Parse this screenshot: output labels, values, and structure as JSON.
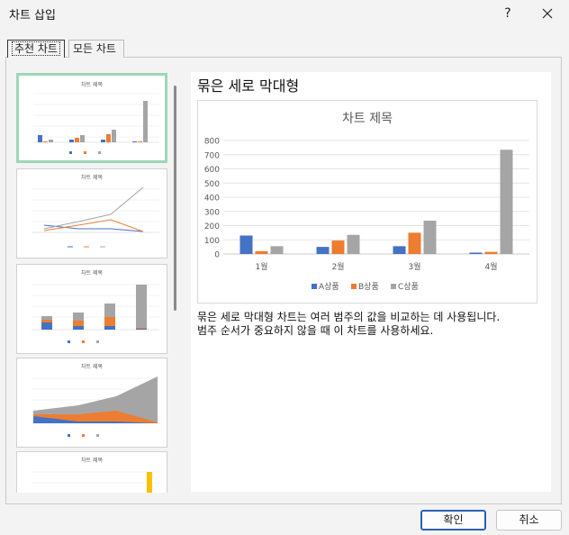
{
  "window": {
    "title": "차트 삽입",
    "help_label": "?"
  },
  "tabs": [
    {
      "label": "추천 차트",
      "selected": true
    },
    {
      "label": "모든 차트",
      "selected": false
    }
  ],
  "thumbnails": [
    {
      "title": "차트 제목",
      "kind": "clustered-column",
      "selected": true
    },
    {
      "title": "차트 제목",
      "kind": "line",
      "selected": false
    },
    {
      "title": "차트 제목",
      "kind": "stacked-column",
      "selected": false
    },
    {
      "title": "차트 제목",
      "kind": "stacked-area",
      "selected": false
    },
    {
      "title": "차트 제목",
      "kind": "column-partial",
      "selected": false
    }
  ],
  "preview": {
    "heading": "묶은 세로 막대형",
    "description_line1": "묶은 세로 막대형 차트는 여러 범주의 값을 비교하는 데 사용됩니다.",
    "description_line2": "범주 순서가 중요하지 않을 때 이 차트를 사용하세요."
  },
  "chart_data": {
    "type": "bar",
    "title": "차트 제목",
    "categories": [
      "1월",
      "2월",
      "3월",
      "4월"
    ],
    "series": [
      {
        "name": "A상품",
        "color": "#4472c4",
        "values": [
          130,
          50,
          55,
          10
        ]
      },
      {
        "name": "B상품",
        "color": "#ed7d31",
        "values": [
          20,
          95,
          150,
          15
        ]
      },
      {
        "name": "C상품",
        "color": "#a5a5a5",
        "values": [
          55,
          135,
          235,
          735
        ]
      }
    ],
    "yticks": [
      "0",
      "100",
      "200",
      "300",
      "400",
      "500",
      "600",
      "700",
      "800"
    ],
    "ylim": [
      0,
      800
    ],
    "grid": true,
    "legend": "bottom"
  },
  "buttons": {
    "ok": "확인",
    "cancel": "취소"
  }
}
